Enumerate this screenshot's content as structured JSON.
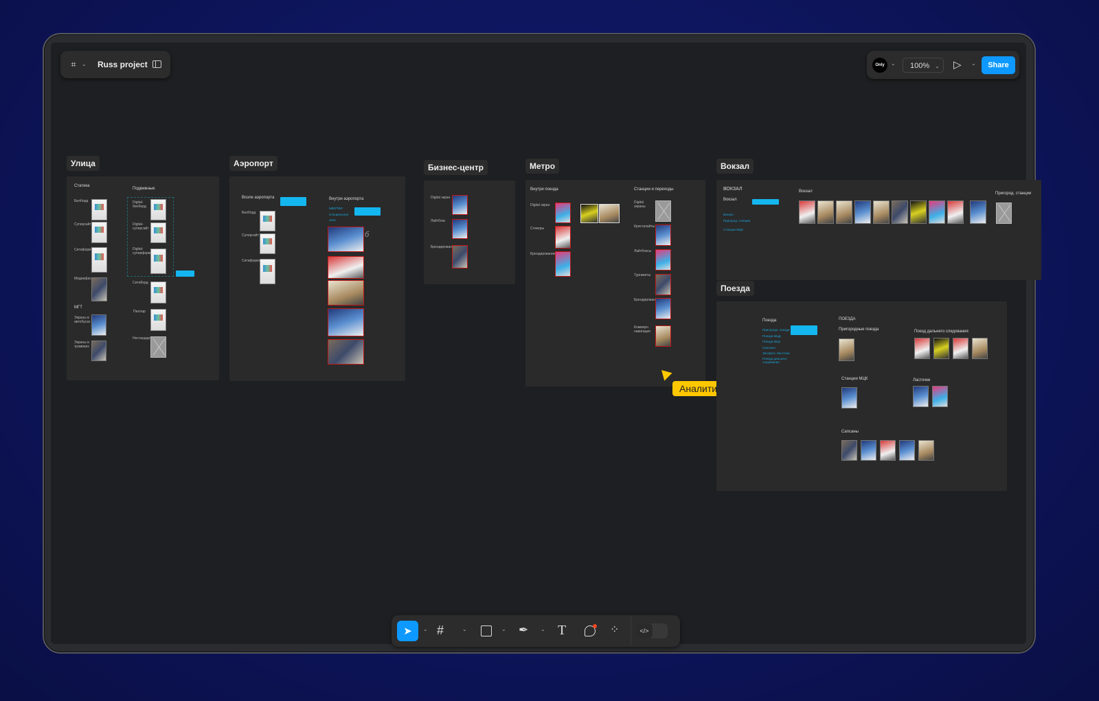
{
  "app": {
    "project_name": "Russ project",
    "zoom": "100%",
    "share_label": "Share",
    "avatar_text": "Only"
  },
  "cursor": {
    "name": "Аналитик",
    "color": "#ffc700"
  },
  "accent": "#0d99ff",
  "frames": {
    "ulitsa": {
      "title": "Улица",
      "static_heading": "Статика",
      "moving_heading": "Подвижные",
      "static": [
        "Билборд",
        "Суперсайт",
        "Ситиформат",
        "Медиафасад"
      ],
      "mgt_heading": "МГТ",
      "mgt": [
        "Экраны в автобусах",
        "Экраны в трамваях"
      ],
      "moving": [
        "Digital-билборд",
        "Digital-суперсайт",
        "Digital-суперформат",
        "Ситиборд",
        "Пиллар",
        "Нестандарты"
      ]
    },
    "airport": {
      "title": "Аэропорт",
      "near_heading": "Возле аэропорта",
      "near": [
        "Билборд",
        "Суперсайт",
        "Ситиформат"
      ],
      "inside_heading": "Внутри аэропорта",
      "links": [
        "МВЛ/ТВЛ",
        "Специальная зона"
      ],
      "handwriting": "б"
    },
    "business": {
      "title": "Бизнес-центр",
      "items": [
        "Digital экран",
        "Лайтбокс",
        "Брендирование"
      ]
    },
    "metro": {
      "title": "Метро",
      "inside_heading": "Внутри поезда",
      "inside": [
        "Digital экран",
        "Стикеры",
        "Брендирование"
      ],
      "stations_heading": "Станции и переходы",
      "stations": [
        "Digital экраны",
        "Кристалайты",
        "Лайтбоксы",
        "Турникеты",
        "Брендирование",
        "Коммерч. навигация"
      ]
    },
    "vokzal": {
      "title": "Вокзал",
      "caps_heading": "ВОКЗАЛ",
      "sub": "Вокзал",
      "links": [
        "Вокзал",
        "Пригород. станции",
        "Станции МЦК"
      ],
      "gallery_heading": "Вокзал",
      "suburb_heading": "Пригород. станции"
    },
    "trains": {
      "title": "Поезда",
      "side_heading": "Поезда",
      "links": [
        "Пригородн. поезда",
        "Поезда МЦД",
        "Поезда МЦК",
        "Сапсаны",
        "Экспресс Ласточки",
        "Поезда дальнего следования"
      ],
      "caps_heading": "ПОЕЗДА",
      "suburban": "Пригородные поезда",
      "long": "Поезд дальнего следования",
      "mck": "Станции МЦК",
      "lastochki": "Ласточки",
      "sapsan": "Сапсаны"
    }
  }
}
